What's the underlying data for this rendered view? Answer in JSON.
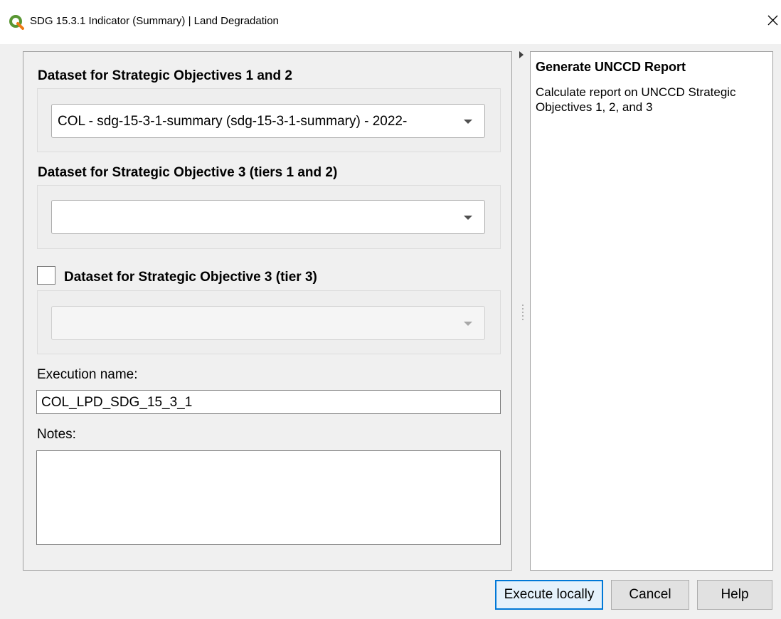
{
  "window": {
    "title": "SDG 15.3.1 Indicator (Summary) | Land Degradation",
    "icon": "qgis-logo-icon"
  },
  "form": {
    "so12": {
      "heading": "Dataset for Strategic Objectives 1 and 2",
      "selected": "COL - sdg-15-3-1-summary (sdg-15-3-1-summary) - 2022-"
    },
    "so3_t12": {
      "heading": "Dataset for Strategic Objective 3 (tiers 1 and 2)",
      "selected": ""
    },
    "so3_t3": {
      "heading": "Dataset for Strategic Objective 3 (tier 3)",
      "checked": false,
      "selected": ""
    },
    "execution_name_label": "Execution name:",
    "execution_name_value": "COL_LPD_SDG_15_3_1",
    "notes_label": "Notes:",
    "notes_value": ""
  },
  "info_panel": {
    "title": "Generate UNCCD Report",
    "description": "Calculate report on UNCCD Strategic Objectives 1, 2, and 3"
  },
  "buttons": {
    "execute": "Execute locally",
    "cancel": "Cancel",
    "help": "Help"
  },
  "colors": {
    "qgis_green": "#589632",
    "accent": "#0078d7"
  }
}
